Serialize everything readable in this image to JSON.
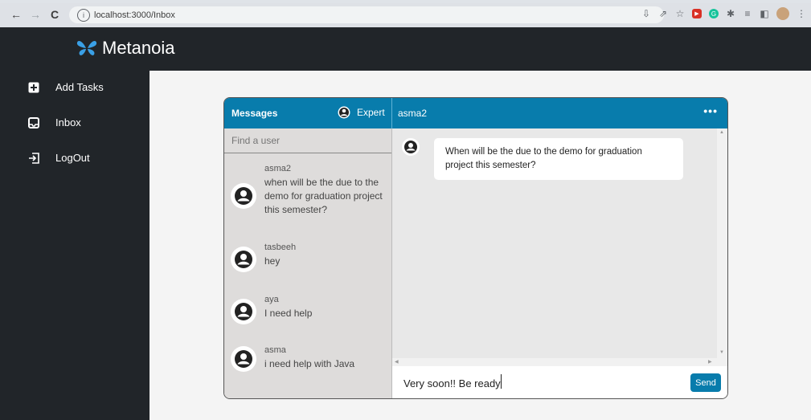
{
  "browser": {
    "url": "localhost:3000/Inbox",
    "info_glyph": "i"
  },
  "app": {
    "brand": "Metanoia",
    "brand_icon": "butterfly-icon",
    "accent_color": "#087cac"
  },
  "sidebar": {
    "items": [
      {
        "label": "Add Tasks",
        "icon": "plus-square-icon"
      },
      {
        "label": "Inbox",
        "icon": "inbox-icon"
      },
      {
        "label": "LogOut",
        "icon": "logout-icon"
      }
    ]
  },
  "messages": {
    "title": "Messages",
    "role_label": "Expert",
    "active_user": "asma2",
    "more_glyph": "•••",
    "search_placeholder": "Find a user",
    "contacts": [
      {
        "name": "asma2",
        "message": "when will be the due to the demo for graduation project this semester?"
      },
      {
        "name": "tasbeeh",
        "message": "hey"
      },
      {
        "name": "aya",
        "message": "I need help"
      },
      {
        "name": "asma",
        "message": "i need help with Java"
      }
    ],
    "conversation": [
      {
        "text": "When will be the due to the demo for graduation project this semester?"
      }
    ],
    "composer_value": "Very soon!! Be ready",
    "send_label": "Send"
  }
}
